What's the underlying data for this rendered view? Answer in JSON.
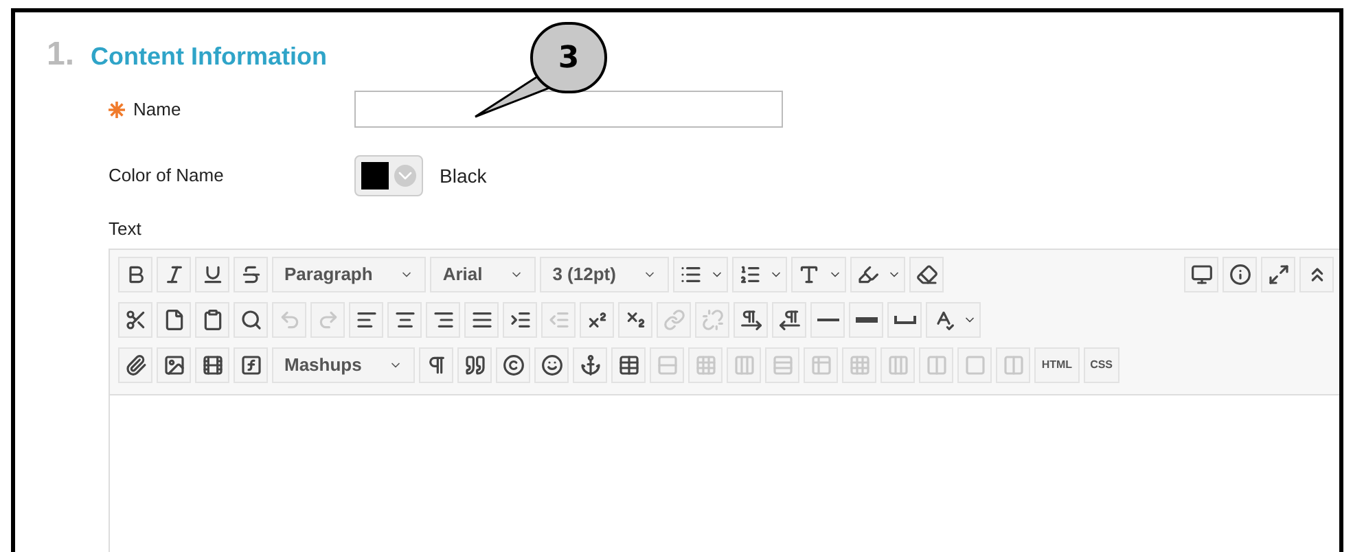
{
  "section": {
    "number": "1.",
    "title": "Content Information"
  },
  "name_field": {
    "label": "Name",
    "required": true
  },
  "color_field": {
    "label": "Color of Name",
    "color": "#000000",
    "value": "Black"
  },
  "text_editor": {
    "label": "Text",
    "toolbar_rows": [
      {
        "items": [
          {
            "kind": "button",
            "disabled": false
          },
          {
            "kind": "button",
            "disabled": false
          },
          {
            "kind": "button",
            "disabled": false
          },
          {
            "kind": "button",
            "disabled": false
          },
          {
            "kind": "dropdown",
            "value": "Paragraph"
          },
          {
            "kind": "dropdown",
            "value": "Arial"
          },
          {
            "kind": "dropdown",
            "value": "3 (12pt)"
          },
          {
            "kind": "split",
            "disabled": false
          },
          {
            "kind": "split",
            "disabled": false
          },
          {
            "kind": "split",
            "disabled": false
          },
          {
            "kind": "split",
            "disabled": false
          },
          {
            "kind": "button",
            "disabled": false
          }
        ],
        "right_items": [
          {
            "kind": "button",
            "disabled": false
          },
          {
            "kind": "button",
            "disabled": false
          },
          {
            "kind": "button",
            "disabled": false
          },
          {
            "kind": "button",
            "disabled": false
          }
        ]
      },
      {
        "items": [
          {
            "kind": "button",
            "disabled": false
          },
          {
            "kind": "button",
            "disabled": false
          },
          {
            "kind": "button",
            "disabled": false
          },
          {
            "kind": "button",
            "disabled": false
          },
          {
            "kind": "button",
            "disabled": true
          },
          {
            "kind": "button",
            "disabled": true
          },
          {
            "kind": "button",
            "disabled": false
          },
          {
            "kind": "button",
            "disabled": false
          },
          {
            "kind": "button",
            "disabled": false
          },
          {
            "kind": "button",
            "disabled": false
          },
          {
            "kind": "button",
            "disabled": false
          },
          {
            "kind": "button",
            "disabled": true
          },
          {
            "kind": "button",
            "disabled": false
          },
          {
            "kind": "button",
            "disabled": false
          },
          {
            "kind": "button",
            "disabled": true
          },
          {
            "kind": "button",
            "disabled": true
          },
          {
            "kind": "button",
            "disabled": false
          },
          {
            "kind": "button",
            "disabled": false
          },
          {
            "kind": "button",
            "disabled": false
          },
          {
            "kind": "button",
            "disabled": false
          },
          {
            "kind": "button",
            "disabled": false
          },
          {
            "kind": "split",
            "disabled": false
          }
        ]
      },
      {
        "items": [
          {
            "kind": "button",
            "disabled": false
          },
          {
            "kind": "button",
            "disabled": false
          },
          {
            "kind": "button",
            "disabled": false
          },
          {
            "kind": "button",
            "disabled": false
          },
          {
            "kind": "dropdown",
            "value": "Mashups"
          },
          {
            "kind": "button",
            "disabled": false
          },
          {
            "kind": "button",
            "disabled": false
          },
          {
            "kind": "button",
            "disabled": false
          },
          {
            "kind": "button",
            "disabled": false
          },
          {
            "kind": "button",
            "disabled": false
          },
          {
            "kind": "button",
            "disabled": false
          },
          {
            "kind": "button",
            "disabled": true
          },
          {
            "kind": "button",
            "disabled": true
          },
          {
            "kind": "button",
            "disabled": true
          },
          {
            "kind": "button",
            "disabled": true
          },
          {
            "kind": "button",
            "disabled": true
          },
          {
            "kind": "button",
            "disabled": true
          },
          {
            "kind": "button",
            "disabled": true
          },
          {
            "kind": "button",
            "disabled": true
          },
          {
            "kind": "button",
            "disabled": true
          },
          {
            "kind": "button",
            "disabled": true
          },
          {
            "kind": "text",
            "label": "HTML"
          },
          {
            "kind": "text",
            "label": "CSS"
          }
        ]
      }
    ]
  },
  "callout": {
    "label": "3"
  }
}
